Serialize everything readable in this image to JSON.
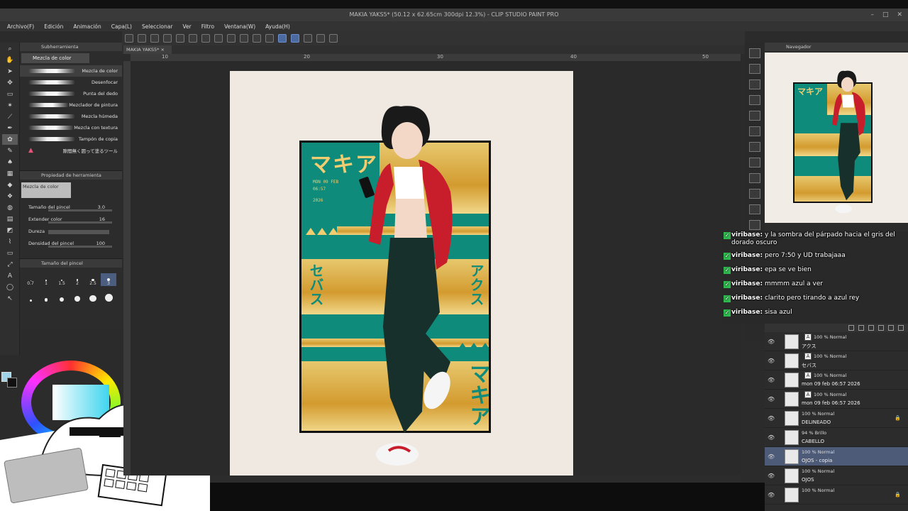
{
  "window": {
    "title": "MAKIA YAKS5* (50.12 x 62.65cm 300dpi 12.3%) - CLIP STUDIO PAINT PRO"
  },
  "menu": [
    "Archivo(F)",
    "Edición",
    "Animación",
    "Capa(L)",
    "Seleccionar",
    "Ver",
    "Filtro",
    "Ventana(W)",
    "Ayuda(H)"
  ],
  "document_tab": "MAKIA YAKS5*",
  "rulers": {
    "h": [
      "10",
      "20",
      "30",
      "40",
      "50"
    ]
  },
  "subtool": {
    "panel_title": "Subherramienta",
    "group": "Mezcla de color",
    "items": [
      {
        "label": "Mezcla de color"
      },
      {
        "label": "Desenfocar"
      },
      {
        "label": "Punta del dedo"
      },
      {
        "label": "Mezclador de pintura"
      },
      {
        "label": "Mezcla húmeda"
      },
      {
        "label": "Mezcla con textura"
      },
      {
        "label": "Tampón de copia"
      },
      {
        "label": "隙間無く囲って塗るツール"
      }
    ]
  },
  "tool_property": {
    "panel_title": "Propiedad de herramienta",
    "preview_label": "Mezcla de color",
    "rows": [
      {
        "label": "Tamaño del pincel",
        "value": "3.0"
      },
      {
        "label": "Extender color",
        "value": "16"
      },
      {
        "label": "Dureza",
        "value": ""
      },
      {
        "label": "Densidad del pincel",
        "value": "100"
      }
    ]
  },
  "brush_size": {
    "panel_title": "Tamaño del pincel",
    "sizes": [
      "0.7",
      "1",
      "1.5",
      "2",
      "2.5",
      "3",
      "4",
      "5",
      "6",
      "7",
      "8",
      "10"
    ],
    "selected": "3"
  },
  "colors": {
    "main": "#9fd3e8",
    "sub": "#111111",
    "art_teal": "#0e8b7b",
    "art_gold": "#d9a640",
    "chat_badge": "#2fb84d"
  },
  "artwork": {
    "title_jp_top": "マキア",
    "title_jp_bottom": "マキア",
    "side_left": "セバス",
    "side_right": "アクス",
    "date_line1": "MON 09 FEB",
    "date_line2": "06:57",
    "date_line3": "2026"
  },
  "navigator": {
    "panel_title": "Navegador"
  },
  "chat": [
    {
      "user": "viribase:",
      "text": "y la sombra del párpado hacia el gris del dorado oscuro"
    },
    {
      "user": "viribase:",
      "text": "pero 7:50 y UD trabajaaa"
    },
    {
      "user": "viribase:",
      "text": "epa se ve bien"
    },
    {
      "user": "viribase:",
      "text": "mmmm azul a ver"
    },
    {
      "user": "viribase:",
      "text": "clarito pero tirando a azul rey"
    },
    {
      "user": "viribase:",
      "text": "sisa azul"
    }
  ],
  "layers": [
    {
      "mode": "100 % Normal",
      "name": "アクス",
      "type": "A",
      "selected": false,
      "lock": false
    },
    {
      "mode": "100 % Normal",
      "name": "セバス",
      "type": "A",
      "selected": false,
      "lock": false
    },
    {
      "mode": "100 % Normal",
      "name": "mon 09 feb 06:57 2026",
      "type": "A",
      "selected": false,
      "lock": false
    },
    {
      "mode": "100 % Normal",
      "name": "mon 09 feb 06:57 2026",
      "type": "A",
      "selected": false,
      "lock": false
    },
    {
      "mode": "100 % Normal",
      "name": "DELINEADO",
      "type": "",
      "selected": false,
      "lock": true
    },
    {
      "mode": "94 % Brillo",
      "name": "CABELLO",
      "type": "",
      "selected": false,
      "lock": false
    },
    {
      "mode": "100 % Normal",
      "name": "OJOS - copia",
      "type": "",
      "selected": true,
      "lock": false
    },
    {
      "mode": "100 % Normal",
      "name": "OJOS",
      "type": "",
      "selected": false,
      "lock": false
    },
    {
      "mode": "100 % Normal",
      "name": "",
      "type": "",
      "selected": false,
      "lock": true
    }
  ]
}
